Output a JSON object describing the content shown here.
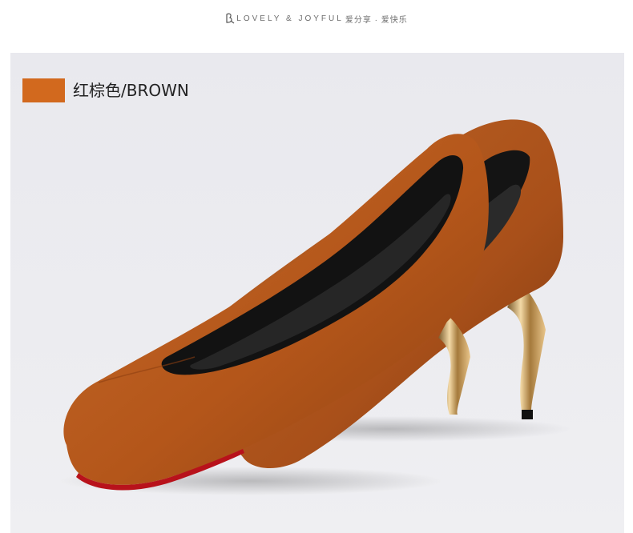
{
  "brand": {
    "tagline": "LOVELY & JOYFUL",
    "tagline_cn": "爱分享 · 爱快乐"
  },
  "variant": {
    "label": "红棕色/BROWN",
    "swatch_color": "#d2691e"
  },
  "colors": {
    "suede": "#b85a1d",
    "suede_shadow": "#8a3f10",
    "lining": "#1a1a1a",
    "heel": "#c9a063",
    "sole_red": "#b8121b"
  }
}
